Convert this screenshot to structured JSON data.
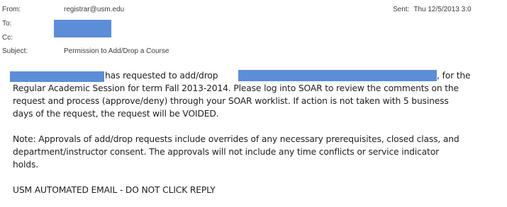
{
  "header": {
    "from_label": "From:",
    "from_value": "registrar@usm.edu",
    "to_label": "To:",
    "cc_label": "Cc:",
    "subject_label": "Subject:",
    "subject_value": "Permission to Add/Drop a Course",
    "sent_label": "Sent:",
    "sent_value": "Thu 12/5/2013 3:0"
  },
  "body": {
    "p1_l1_prefix": "",
    "p1_l1_mid": " has requested to add/drop ",
    "p1_l1_end": ", for the",
    "p1_l2": "Regular Academic Session for term Fall 2013-2014. Please log into SOAR to review the comments on the",
    "p1_l3": "request and process (approve/deny) through your SOAR worklist. If action is not taken with 5 business",
    "p1_l4": "days of the request, the request will be VOIDED.",
    "p2_l1": "Note: Approvals of add/drop requests include overrides of any necessary prerequisites, closed class, and",
    "p2_l2": "department/instructor consent.  The approvals will not include any time conflicts or service indicator",
    "p2_l3": "holds.",
    "footer": "USM AUTOMATED EMAIL - DO NOT CLICK REPLY"
  }
}
